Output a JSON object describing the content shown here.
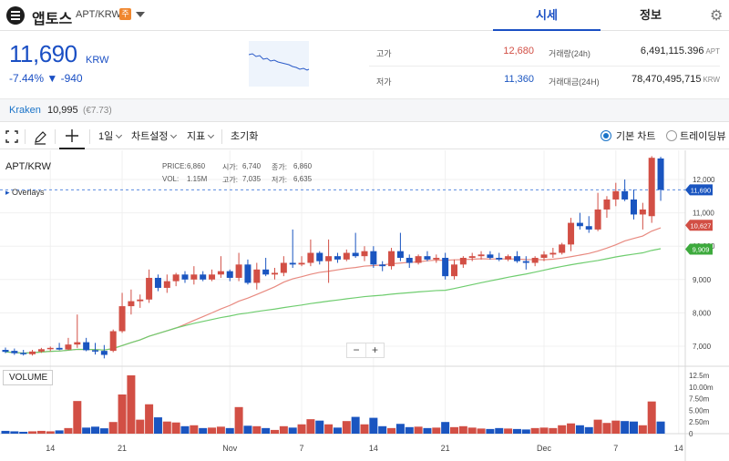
{
  "header": {
    "coin_name": "앱토스",
    "pair": "APT/KRW",
    "caution_badge": "주",
    "tabs": [
      "시세",
      "정보"
    ]
  },
  "price": {
    "current": "11,690",
    "unit": "KRW",
    "change_text": "-7.44% ▼ -940"
  },
  "stats": {
    "high_label": "고가",
    "high": "12,680",
    "low_label": "저가",
    "low": "11,360",
    "volume_label": "거래량(24h)",
    "volume": "6,491,115.396",
    "volume_unit": "APT",
    "amount_label": "거래대금(24H)",
    "amount": "78,470,495,715",
    "amount_unit": "KRW"
  },
  "exchange": {
    "name": "Kraken",
    "price": "10,995",
    "krw": "(€7.73)"
  },
  "toolbar": {
    "interval": "1일",
    "chart_settings": "차트설정",
    "indicators": "지표",
    "reset": "초기화",
    "radio_basic": "기본 차트",
    "radio_tradingview": "트레이딩뷰"
  },
  "legend": {
    "symbol": "APT/KRW",
    "overlays": "Overlays",
    "price_label": "PRICE:",
    "price_value": "6,860",
    "open_label": "시가:",
    "open_value": "6,740",
    "close_label": "종가:",
    "close_value": "6,860",
    "vol_label": "VOL:",
    "vol_value": "1.15M",
    "high_label": "고가:",
    "high_value": "7,035",
    "low_label": "저가:",
    "low_value": "6,635"
  },
  "volume_panel_label": "VOLUME",
  "colors": {
    "up": "#d24f45",
    "down": "#1a55c0",
    "ma_short": "#e88a80",
    "ma_long": "#6fcd6f",
    "accent": "#1a4fc4"
  },
  "chart_data": {
    "type": "candlestick",
    "y_ticks": [
      "12,000",
      "11,000",
      "10,000",
      "9,000",
      "8,000",
      "7,000"
    ],
    "volume_ticks": [
      "12.5m",
      "10.00m",
      "7.50m",
      "5.00m",
      "2.50m",
      "0"
    ],
    "x_ticks": [
      "14",
      "21",
      "Nov",
      "7",
      "14",
      "21",
      "Dec",
      "7",
      "14"
    ],
    "price_markers": [
      {
        "label": "11,690",
        "value": 11690,
        "color": "#1a55c0"
      },
      {
        "label": "10,627",
        "value": 10627,
        "color": "#d24f45"
      },
      {
        "label": "9,909",
        "value": 9909,
        "color": "#3daa3d"
      }
    ],
    "ylim": [
      6600,
      12700
    ],
    "volume_max": 12.5,
    "candles": [
      {
        "o": 6890,
        "h": 6960,
        "l": 6790,
        "c": 6830,
        "v": 0.6
      },
      {
        "o": 6860,
        "h": 6930,
        "l": 6740,
        "c": 6790,
        "v": 0.5
      },
      {
        "o": 6800,
        "h": 6890,
        "l": 6720,
        "c": 6760,
        "v": 0.4
      },
      {
        "o": 6760,
        "h": 6890,
        "l": 6720,
        "c": 6840,
        "v": 0.5
      },
      {
        "o": 6840,
        "h": 6950,
        "l": 6800,
        "c": 6910,
        "v": 0.6
      },
      {
        "o": 6910,
        "h": 6990,
        "l": 6850,
        "c": 6950,
        "v": 0.5
      },
      {
        "o": 6950,
        "h": 7100,
        "l": 6880,
        "c": 6900,
        "v": 0.7
      },
      {
        "o": 6900,
        "h": 7250,
        "l": 6880,
        "c": 7050,
        "v": 1.2
      },
      {
        "o": 7050,
        "h": 7950,
        "l": 6950,
        "c": 7120,
        "v": 7.0
      },
      {
        "o": 7120,
        "h": 7250,
        "l": 6850,
        "c": 6880,
        "v": 1.3
      },
      {
        "o": 6880,
        "h": 7100,
        "l": 6750,
        "c": 6860,
        "v": 1.5
      },
      {
        "o": 6860,
        "h": 7035,
        "l": 6635,
        "c": 6740,
        "v": 1.15
      },
      {
        "o": 6860,
        "h": 7500,
        "l": 6820,
        "c": 7450,
        "v": 2.5
      },
      {
        "o": 7450,
        "h": 8600,
        "l": 7400,
        "c": 8200,
        "v": 8.4
      },
      {
        "o": 8200,
        "h": 8700,
        "l": 7950,
        "c": 8350,
        "v": 12.5
      },
      {
        "o": 8350,
        "h": 8550,
        "l": 8150,
        "c": 8400,
        "v": 3.0
      },
      {
        "o": 8400,
        "h": 9300,
        "l": 8300,
        "c": 9050,
        "v": 6.3
      },
      {
        "o": 9050,
        "h": 9150,
        "l": 8650,
        "c": 8750,
        "v": 3.5
      },
      {
        "o": 8750,
        "h": 9150,
        "l": 8600,
        "c": 8950,
        "v": 2.6
      },
      {
        "o": 8950,
        "h": 9200,
        "l": 8800,
        "c": 9150,
        "v": 2.4
      },
      {
        "o": 9150,
        "h": 9250,
        "l": 8900,
        "c": 9000,
        "v": 1.6
      },
      {
        "o": 9000,
        "h": 9400,
        "l": 8850,
        "c": 9150,
        "v": 1.8
      },
      {
        "o": 9150,
        "h": 9250,
        "l": 8950,
        "c": 9000,
        "v": 1.2
      },
      {
        "o": 9000,
        "h": 9300,
        "l": 8950,
        "c": 9150,
        "v": 1.3
      },
      {
        "o": 9150,
        "h": 9700,
        "l": 9050,
        "c": 9250,
        "v": 1.5
      },
      {
        "o": 9250,
        "h": 9300,
        "l": 8950,
        "c": 9050,
        "v": 1.2
      },
      {
        "o": 9050,
        "h": 9800,
        "l": 8950,
        "c": 9450,
        "v": 5.7
      },
      {
        "o": 9450,
        "h": 9600,
        "l": 8850,
        "c": 8900,
        "v": 1.7
      },
      {
        "o": 8900,
        "h": 9500,
        "l": 8700,
        "c": 9300,
        "v": 1.6
      },
      {
        "o": 9300,
        "h": 9650,
        "l": 9100,
        "c": 9150,
        "v": 1.2
      },
      {
        "o": 9150,
        "h": 9350,
        "l": 9000,
        "c": 9200,
        "v": 0.8
      },
      {
        "o": 9200,
        "h": 9700,
        "l": 9100,
        "c": 9500,
        "v": 1.6
      },
      {
        "o": 9500,
        "h": 10500,
        "l": 9350,
        "c": 9450,
        "v": 1.3
      },
      {
        "o": 9450,
        "h": 9700,
        "l": 9400,
        "c": 9500,
        "v": 2.0
      },
      {
        "o": 9500,
        "h": 10200,
        "l": 9400,
        "c": 9800,
        "v": 3.1
      },
      {
        "o": 9800,
        "h": 9850,
        "l": 9450,
        "c": 9550,
        "v": 2.8
      },
      {
        "o": 9550,
        "h": 10200,
        "l": 8900,
        "c": 9700,
        "v": 2.0
      },
      {
        "o": 9700,
        "h": 9800,
        "l": 9500,
        "c": 9600,
        "v": 1.3
      },
      {
        "o": 9600,
        "h": 9900,
        "l": 9550,
        "c": 9800,
        "v": 2.7
      },
      {
        "o": 9800,
        "h": 10400,
        "l": 9650,
        "c": 9700,
        "v": 3.6
      },
      {
        "o": 9700,
        "h": 10000,
        "l": 9550,
        "c": 9850,
        "v": 2.0
      },
      {
        "o": 9850,
        "h": 10000,
        "l": 9350,
        "c": 9450,
        "v": 3.4
      },
      {
        "o": 9450,
        "h": 9550,
        "l": 9250,
        "c": 9400,
        "v": 1.6
      },
      {
        "o": 9400,
        "h": 9950,
        "l": 9300,
        "c": 9850,
        "v": 1.2
      },
      {
        "o": 9850,
        "h": 10400,
        "l": 9550,
        "c": 9650,
        "v": 2.1
      },
      {
        "o": 9650,
        "h": 9750,
        "l": 9350,
        "c": 9500,
        "v": 1.4
      },
      {
        "o": 9500,
        "h": 9750,
        "l": 9450,
        "c": 9700,
        "v": 1.5
      },
      {
        "o": 9700,
        "h": 9850,
        "l": 9550,
        "c": 9600,
        "v": 1.2
      },
      {
        "o": 9600,
        "h": 9750,
        "l": 9500,
        "c": 9650,
        "v": 1.3
      },
      {
        "o": 9650,
        "h": 9800,
        "l": 9000,
        "c": 9100,
        "v": 2.5
      },
      {
        "o": 9100,
        "h": 9600,
        "l": 9000,
        "c": 9450,
        "v": 1.4
      },
      {
        "o": 9450,
        "h": 9700,
        "l": 9350,
        "c": 9650,
        "v": 1.6
      },
      {
        "o": 9650,
        "h": 9800,
        "l": 9550,
        "c": 9700,
        "v": 1.3
      },
      {
        "o": 9700,
        "h": 9850,
        "l": 9600,
        "c": 9750,
        "v": 1.1
      },
      {
        "o": 9750,
        "h": 9850,
        "l": 9600,
        "c": 9650,
        "v": 1.0
      },
      {
        "o": 9650,
        "h": 9800,
        "l": 9550,
        "c": 9600,
        "v": 1.2
      },
      {
        "o": 9600,
        "h": 9750,
        "l": 9550,
        "c": 9700,
        "v": 1.1
      },
      {
        "o": 9700,
        "h": 9850,
        "l": 9500,
        "c": 9550,
        "v": 1.0
      },
      {
        "o": 9550,
        "h": 9700,
        "l": 9300,
        "c": 9500,
        "v": 0.9
      },
      {
        "o": 9500,
        "h": 9700,
        "l": 9400,
        "c": 9650,
        "v": 1.2
      },
      {
        "o": 9650,
        "h": 9850,
        "l": 9550,
        "c": 9750,
        "v": 1.3
      },
      {
        "o": 9750,
        "h": 9950,
        "l": 9650,
        "c": 9800,
        "v": 1.2
      },
      {
        "o": 9800,
        "h": 10100,
        "l": 9750,
        "c": 10050,
        "v": 1.8
      },
      {
        "o": 10050,
        "h": 10850,
        "l": 9850,
        "c": 10700,
        "v": 2.2
      },
      {
        "o": 10700,
        "h": 11000,
        "l": 10500,
        "c": 10600,
        "v": 1.8
      },
      {
        "o": 10600,
        "h": 10900,
        "l": 10400,
        "c": 10500,
        "v": 1.4
      },
      {
        "o": 10500,
        "h": 11600,
        "l": 10450,
        "c": 11100,
        "v": 3.0
      },
      {
        "o": 11100,
        "h": 11500,
        "l": 10850,
        "c": 11400,
        "v": 2.3
      },
      {
        "o": 11400,
        "h": 11900,
        "l": 11200,
        "c": 11650,
        "v": 2.8
      },
      {
        "o": 11650,
        "h": 12000,
        "l": 11350,
        "c": 11400,
        "v": 2.7
      },
      {
        "o": 11400,
        "h": 11700,
        "l": 10800,
        "c": 10950,
        "v": 2.6
      },
      {
        "o": 10950,
        "h": 11300,
        "l": 10500,
        "c": 11100,
        "v": 1.8
      },
      {
        "o": 10900,
        "h": 12700,
        "l": 10700,
        "c": 12650,
        "v": 6.9
      },
      {
        "o": 12630,
        "h": 12680,
        "l": 11360,
        "c": 11690,
        "v": 2.6
      }
    ]
  }
}
